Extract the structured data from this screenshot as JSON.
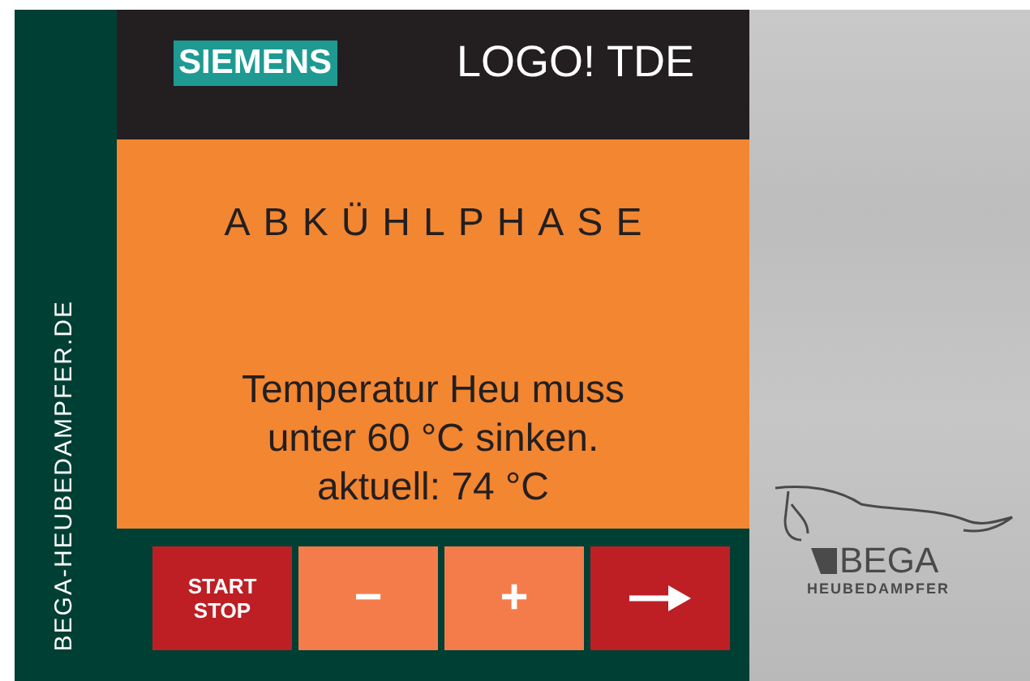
{
  "side_label": "BEGA-HEUBEDAMPFER.DE",
  "header": {
    "brand": "SIEMENS",
    "title": "LOGO! TDE"
  },
  "status": {
    "phase": "ABKÜHLPHASE",
    "message_lines": [
      "Temperatur Heu muss",
      "unter 60 °C sinken.",
      "aktuell: 74 °C"
    ]
  },
  "buttons": [
    {
      "kind": "text",
      "label": "START STOP",
      "color": "#bd1f25"
    },
    {
      "kind": "text",
      "label": "−",
      "color": "#f47c4a"
    },
    {
      "kind": "text",
      "label": "+",
      "color": "#f47c4a"
    },
    {
      "kind": "arrow",
      "color": "#bd1f25"
    }
  ],
  "logo": {
    "name": "BEGA",
    "subtitle": "HEUBEDAMPFER"
  }
}
